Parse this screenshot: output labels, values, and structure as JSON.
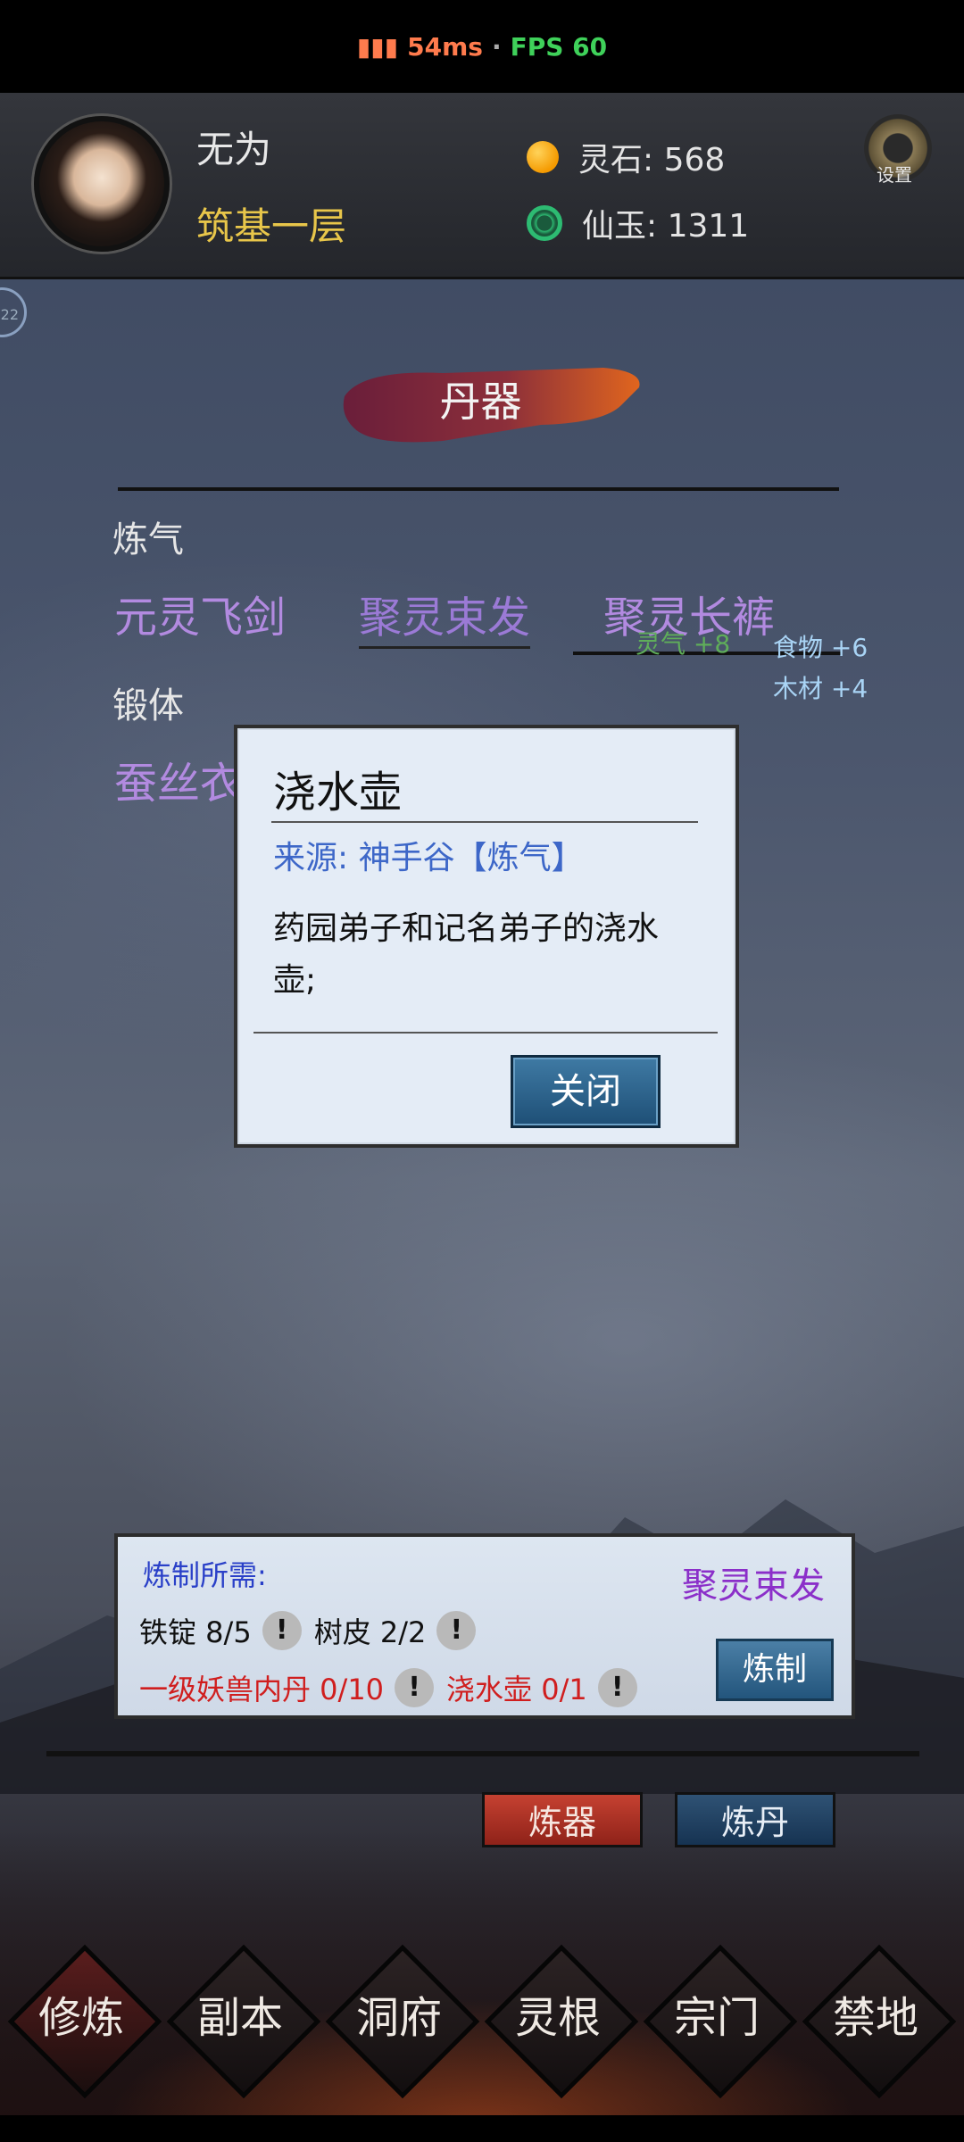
{
  "status": {
    "latency": "54ms",
    "separator": "·",
    "fps": "FPS 60"
  },
  "player": {
    "name": "无为",
    "realm": "筑基一层"
  },
  "resources": {
    "spirit_stone_label": "灵石: 568",
    "jade_label": "仙玉: 1311"
  },
  "settings_label": "设置",
  "side_badge": "22",
  "page_title": "丹器",
  "sections": [
    {
      "label": "炼气",
      "items": [
        "元灵飞剑",
        "聚灵束发",
        "聚灵长裤"
      ]
    },
    {
      "label": "锻体",
      "items": [
        "蚕丝衣"
      ]
    }
  ],
  "gains": {
    "spirit": "灵气 +8",
    "food": "食物 +6",
    "wood": "木材 +4"
  },
  "modal": {
    "title": "浇水壶",
    "source": "来源: 神手谷【炼气】",
    "description": "药园弟子和记名弟子的浇水壶;",
    "close_label": "关闭"
  },
  "craft": {
    "requirements_label": "炼制所需:",
    "target": "聚灵束发",
    "materials_row1": [
      "铁锭 8/5",
      "树皮 2/2"
    ],
    "materials_row2": [
      "一级妖兽内丹 0/10",
      "浇水壶 0/1"
    ],
    "info_glyph": "!",
    "craft_label": "炼制"
  },
  "tabs": {
    "refine_label": "炼器",
    "alchemy_label": "炼丹"
  },
  "nav": [
    "修炼",
    "副本",
    "洞府",
    "灵根",
    "宗门",
    "禁地"
  ],
  "colors": {
    "realm": "#e8c64a",
    "item_link": "#b28ae0",
    "source": "#3d67c8",
    "req_missing": "#d01e1e",
    "refine_btn": "#c54131",
    "alchemy_btn": "#2f5274"
  }
}
